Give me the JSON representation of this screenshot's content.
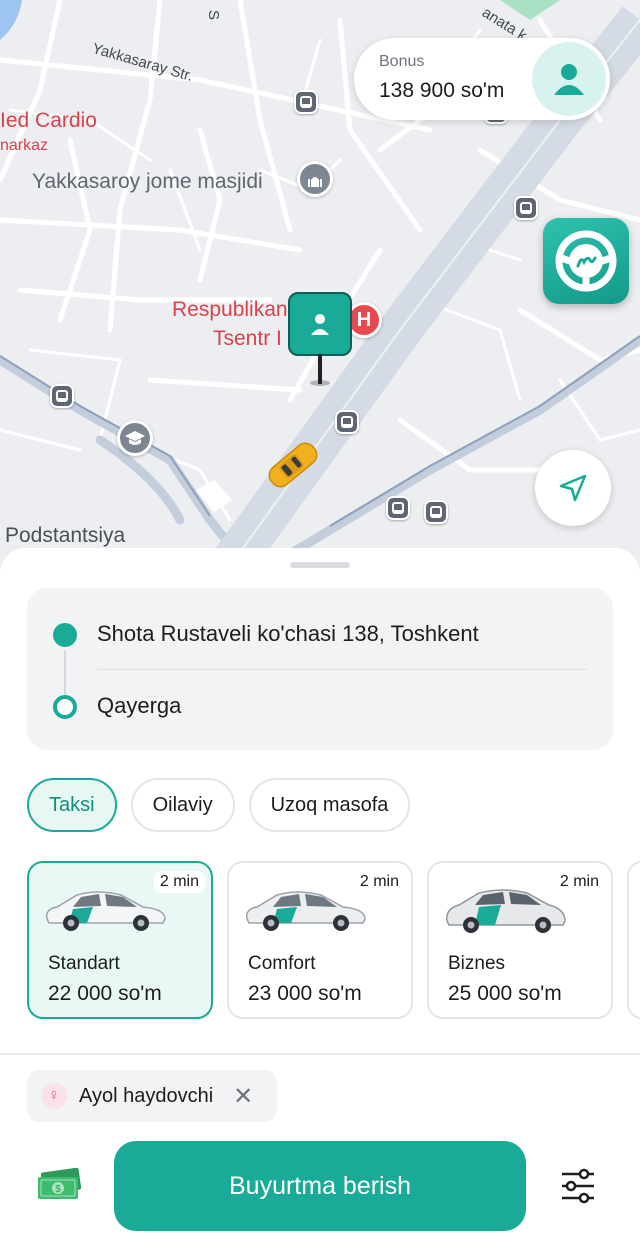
{
  "map": {
    "labels": {
      "street": "Yakkasaray Str.",
      "cardio": "Ied Cardio",
      "markaz": "narkaz",
      "mosque": "Yakkasaroy jome masjidi",
      "hospital_line1": "Respublikan",
      "hospital_line2": "Tsentr I",
      "podstantsiya": "Podstantsiya",
      "top_road": "anata k",
      "top_road2": "S"
    }
  },
  "bonus": {
    "label": "Bonus",
    "value": "138 900 so'm"
  },
  "route": {
    "from": "Shota Rustaveli ko'chasi 138, Toshkent",
    "to": "Qayerga"
  },
  "tabs": [
    {
      "label": "Taksi",
      "active": true
    },
    {
      "label": "Oilaviy",
      "active": false
    },
    {
      "label": "Uzoq masofa",
      "active": false
    }
  ],
  "tariffs": [
    {
      "name": "Standart",
      "price": "22 000 so'm",
      "eta": "2 min",
      "selected": true
    },
    {
      "name": "Comfort",
      "price": "23 000 so'm",
      "eta": "2 min",
      "selected": false
    },
    {
      "name": "Biznes",
      "price": "25 000 so'm",
      "eta": "2 min",
      "selected": false
    }
  ],
  "filter_chip": {
    "label": "Ayol haydovchi",
    "icon": "venus-icon"
  },
  "order_button": {
    "label": "Buyurtma berish"
  },
  "payment": {
    "icon": "cash-icon"
  },
  "colors": {
    "accent": "#1aab98",
    "accent_light": "#e6f7f4",
    "hospital": "#e8484f"
  }
}
